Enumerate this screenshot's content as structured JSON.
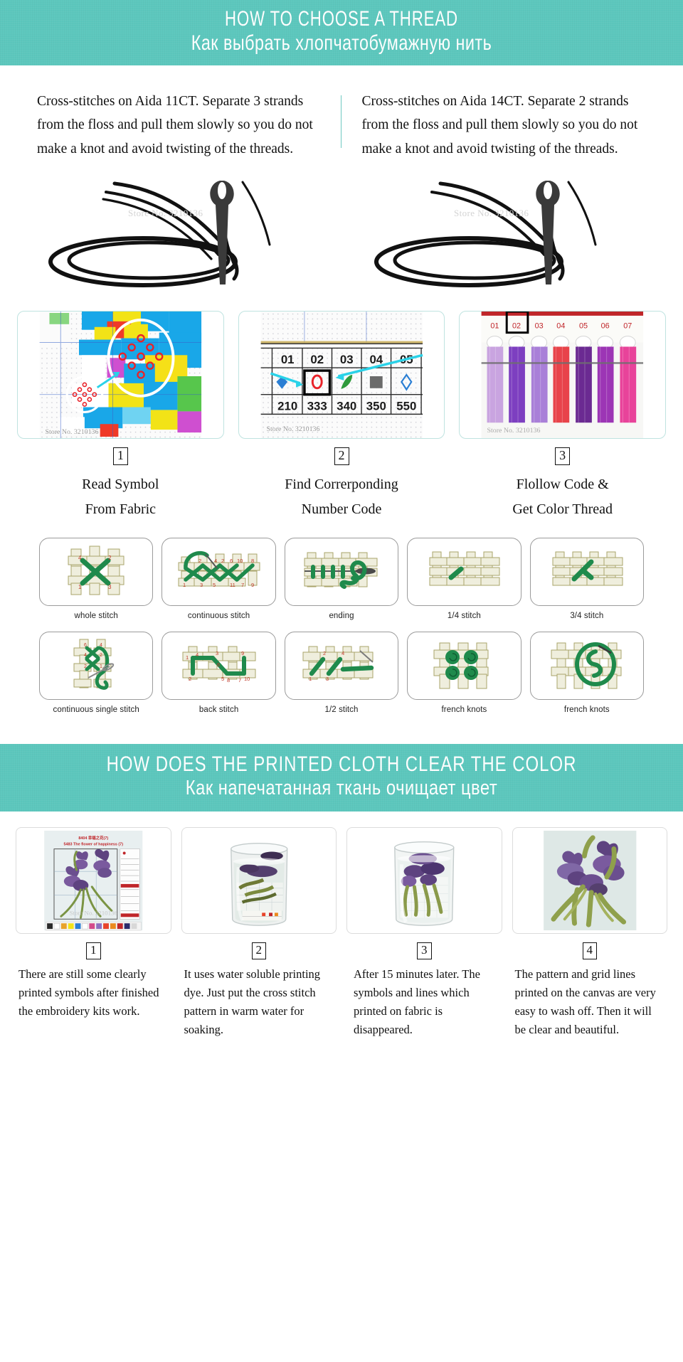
{
  "colors": {
    "banner_teal": "#5cc7bd",
    "banner_text": "#ffffff",
    "divider": "#6fc9c2",
    "stitch_green": "#1f8a4c",
    "fabric_beige": "#efeedd",
    "fabric_outline": "#a9a46a",
    "arrow_cyan": "#2ad2e8",
    "red_symbol": "#e8232a"
  },
  "banner1": {
    "title_en": "HOW TO CHOOSE A THREAD",
    "title_ru": "Как выбрать хлопчатобумажную нить"
  },
  "intro": {
    "left": "Cross-stitches on Aida 11CT. Separate 3 strands from the floss and pull them slowly so you do not make a knot and avoid twisting of the threads.",
    "right": "Cross-stitches on Aida 14CT. Separate 2 strands from the floss and pull them slowly so you do not make a knot and avoid twisting of the threads.",
    "watermark": "Store No. 3210136"
  },
  "steps3": [
    {
      "number": "1",
      "line1": "Read Symbol",
      "line2": "From Fabric"
    },
    {
      "number": "2",
      "line1": "Find Correrponding",
      "line2": "Number Code"
    },
    {
      "number": "3",
      "line1": "Flollow Code &",
      "line2": "Get Color Thread"
    }
  ],
  "chart_photo": {
    "column_numbers": [
      "01",
      "02",
      "03",
      "04",
      "05"
    ],
    "symbols": [
      "diamond-blue",
      "ring-red",
      "leaf-green",
      "square-gray",
      "diamond-outline-blue"
    ],
    "code_numbers": [
      "210",
      "333",
      "340",
      "350",
      "550"
    ],
    "highlighted_column": "02",
    "watermark": "Store No. 3210136"
  },
  "thread_card": {
    "numbers": [
      "01",
      "02",
      "03",
      "04",
      "05",
      "06",
      "07"
    ],
    "highlighted": "02",
    "thread_colors": [
      "#c9a4e0",
      "#7d3fc0",
      "#a97fd8",
      "#e8434a",
      "#6b2a92",
      "#9c35b5",
      "#e8439a"
    ]
  },
  "stitches": {
    "row1": [
      {
        "label": "whole stitch",
        "type": "whole"
      },
      {
        "label": "continuous stitch",
        "type": "continuous"
      },
      {
        "label": "ending",
        "type": "ending"
      },
      {
        "label": "1/4 stitch",
        "type": "quarter"
      },
      {
        "label": "3/4 stitch",
        "type": "threequarter"
      }
    ],
    "row2": [
      {
        "label": "continuous single stitch",
        "type": "single"
      },
      {
        "label": "back stitch",
        "type": "back"
      },
      {
        "label": "1/2 stitch",
        "type": "half"
      },
      {
        "label": "french knots",
        "type": "knots4"
      },
      {
        "label": "french knots",
        "type": "knot-loop"
      }
    ]
  },
  "banner2": {
    "title_en": "HOW DOES THE PRINTED CLOTH CLEAR THE COLOR",
    "title_ru": "Как напечатанная ткань очищает цвет"
  },
  "steps4": [
    {
      "number": "1",
      "caption": "There are still some clearly printed symbols after finished the embroidery kits work.",
      "image": "iris-pattern-chart"
    },
    {
      "number": "2",
      "caption": "It uses water soluble printing dye. Just put the cross stitch pattern in warm water for soaking.",
      "image": "jar-soaking-dirty-water"
    },
    {
      "number": "3",
      "caption": "After 15 minutes later. The symbols and lines which printed on fabric is disappeared.",
      "image": "jar-soaking-clear-water"
    },
    {
      "number": "4",
      "caption": "The pattern and grid lines printed on the canvas are very easy to wash off. Then it will be clear and beautiful.",
      "image": "finished-iris-embroidery"
    }
  ]
}
